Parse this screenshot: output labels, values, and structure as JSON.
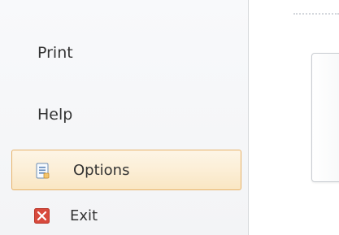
{
  "nav": {
    "print_label": "Print",
    "help_label": "Help",
    "options_label": "Options",
    "exit_label": "Exit"
  },
  "icons": {
    "options": "options-icon",
    "exit": "exit-icon"
  },
  "colors": {
    "selected_border": "#e7b36a",
    "selected_fill": "#fcefd8",
    "exit_icon_red": "#d84a3d"
  }
}
